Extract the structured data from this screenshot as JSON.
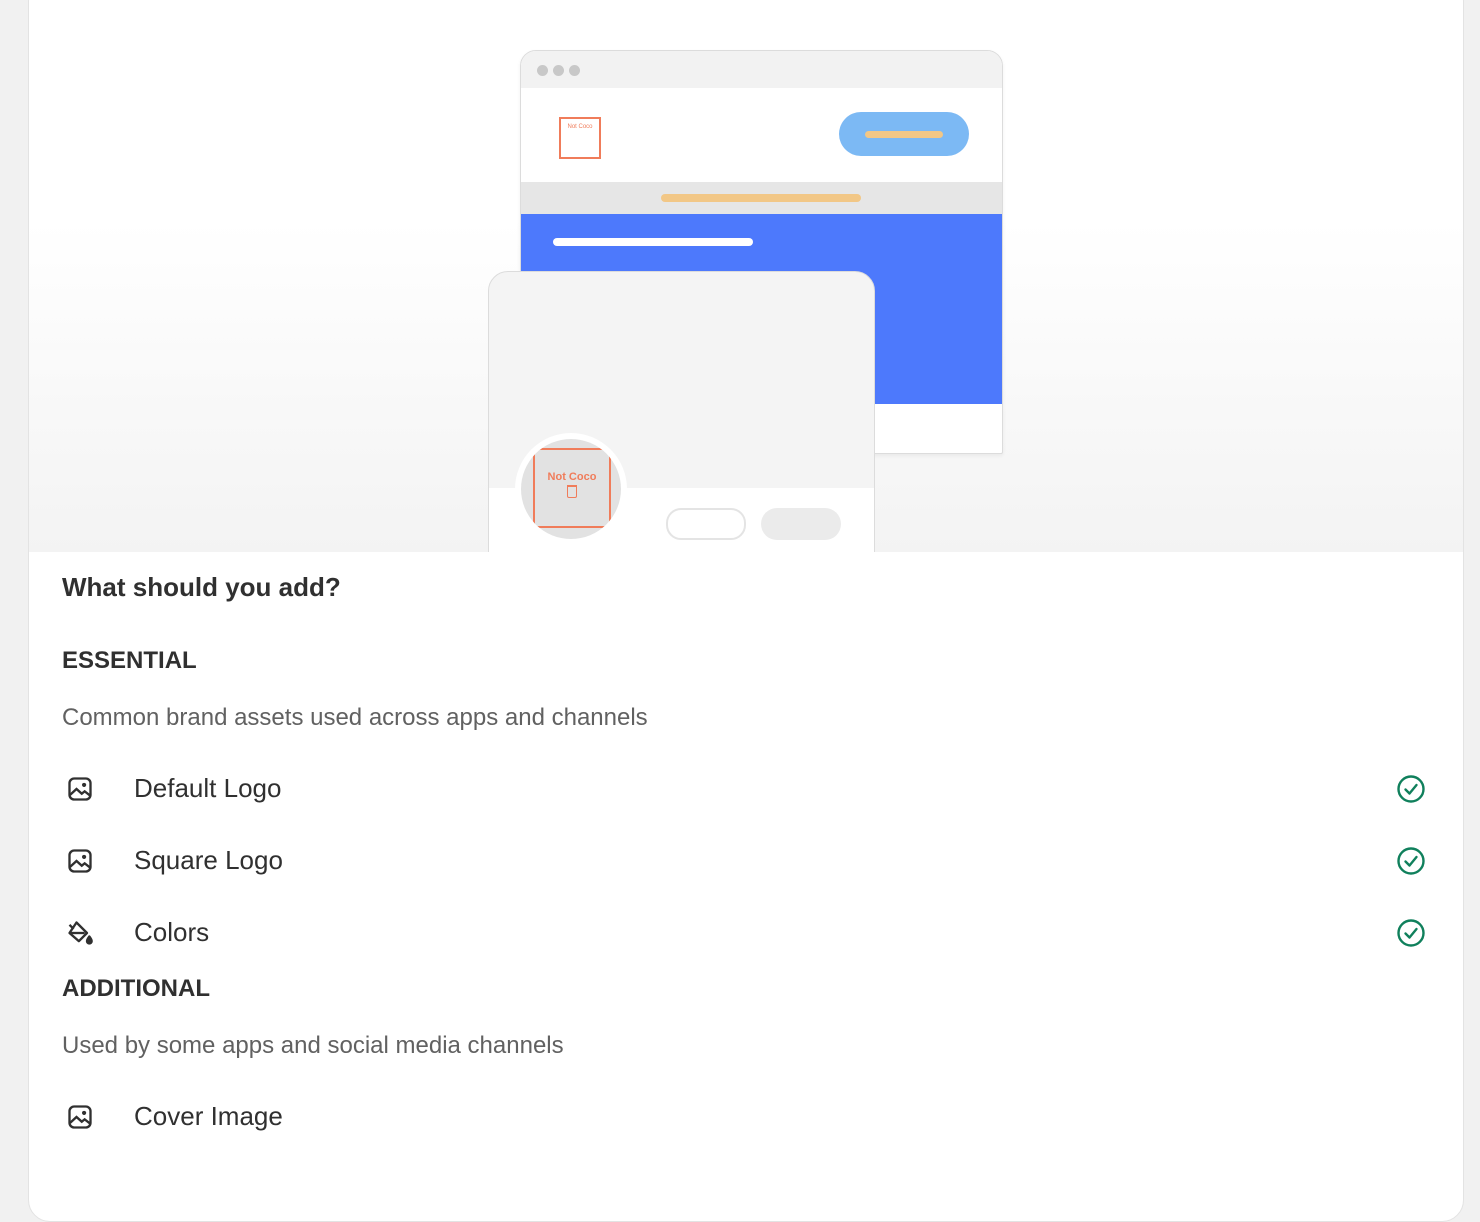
{
  "illustration": {
    "browser_logo_text": "Not Coco",
    "avatar_logo_text": "Not Coco"
  },
  "heading": "What should you add?",
  "essential": {
    "title": "ESSENTIAL",
    "description": "Common brand assets used across apps and channels",
    "items": [
      {
        "label": "Default Logo",
        "icon": "image-icon",
        "done": true
      },
      {
        "label": "Square Logo",
        "icon": "image-icon",
        "done": true
      },
      {
        "label": "Colors",
        "icon": "paint-bucket-icon",
        "done": true
      }
    ]
  },
  "additional": {
    "title": "ADDITIONAL",
    "description": "Used by some apps and social media channels",
    "items": [
      {
        "label": "Cover Image",
        "icon": "image-icon",
        "done": false
      }
    ]
  },
  "colors": {
    "check_green": "#10805c",
    "accent_blue": "#4d79fc",
    "brand_orange": "#f07c5a"
  }
}
